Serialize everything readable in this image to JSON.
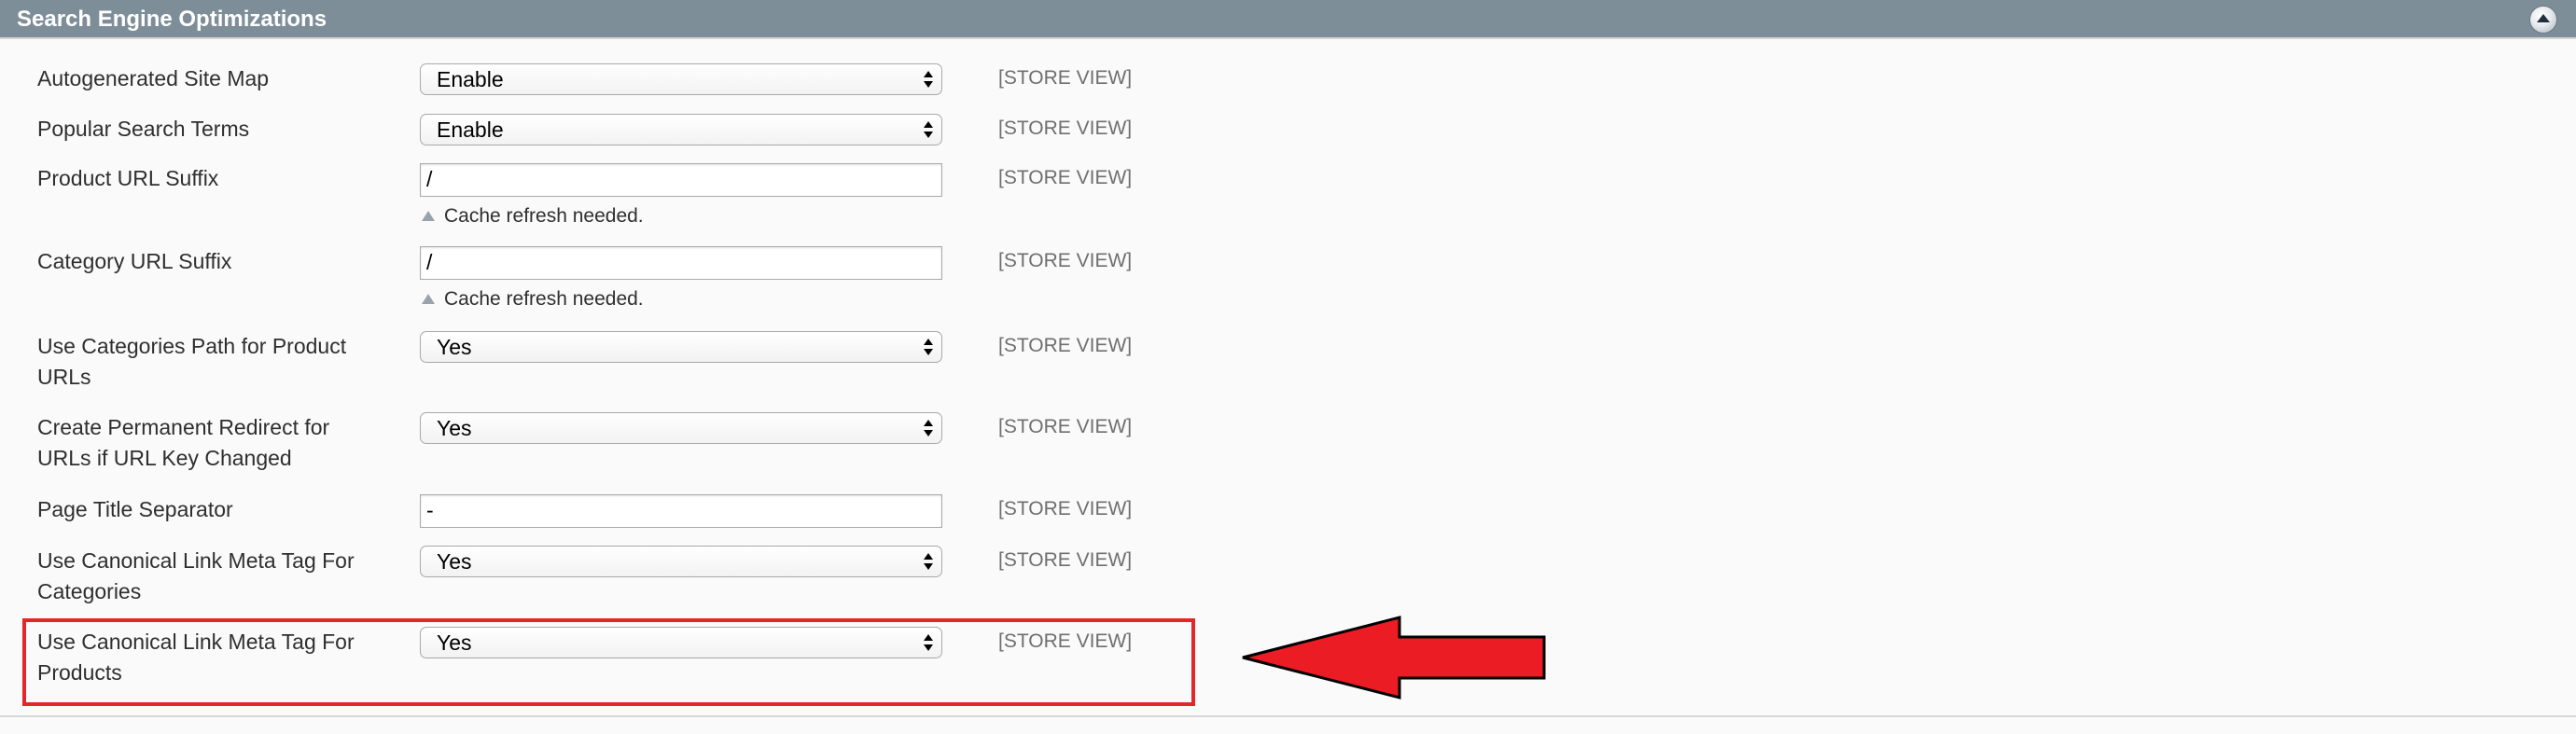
{
  "section": {
    "title": "Search Engine Optimizations",
    "collapse_icon": "collapse-up-icon"
  },
  "rows": [
    {
      "label": "Autogenerated Site Map",
      "control": "select",
      "value": "Enable",
      "scope": "[STORE VIEW]"
    },
    {
      "label": "Popular Search Terms",
      "control": "select",
      "value": "Enable",
      "scope": "[STORE VIEW]"
    },
    {
      "label": "Product URL Suffix",
      "control": "text",
      "value": "/",
      "note": "Cache refresh needed.",
      "scope": "[STORE VIEW]"
    },
    {
      "label": "Category URL Suffix",
      "control": "text",
      "value": "/",
      "note": "Cache refresh needed.",
      "scope": "[STORE VIEW]"
    },
    {
      "label": "Use Categories Path for Product URLs",
      "control": "select",
      "value": "Yes",
      "scope": "[STORE VIEW]"
    },
    {
      "label": "Create Permanent Redirect for URLs if URL Key Changed",
      "control": "select",
      "value": "Yes",
      "scope": "[STORE VIEW]"
    },
    {
      "label": "Page Title Separator",
      "control": "text",
      "value": "-",
      "scope": "[STORE VIEW]"
    },
    {
      "label": "Use Canonical Link Meta Tag For Categories",
      "control": "select",
      "value": "Yes",
      "scope": "[STORE VIEW]"
    },
    {
      "label": "Use Canonical Link Meta Tag For Products",
      "control": "select",
      "value": "Yes",
      "scope": "[STORE VIEW]"
    }
  ],
  "annotation": {
    "highlight_color": "#e4262b",
    "arrow_color": "#ec1c24",
    "arrow_icon": "left-arrow-icon"
  },
  "colors": {
    "header_background": "#7e8e99",
    "header_text": "#ffffff",
    "scope_text": "#6f6f6f"
  }
}
